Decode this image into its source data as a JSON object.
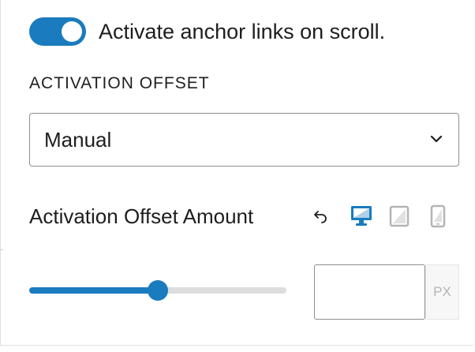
{
  "anchor_toggle": {
    "label": "Activate anchor links on scroll.",
    "checked": true
  },
  "activation_offset": {
    "heading": "ACTIVATION OFFSET",
    "selected": "Manual"
  },
  "offset_amount": {
    "label": "Activation Offset Amount",
    "icons": {
      "reset": "undo-arrow-icon",
      "desktop": "desktop-icon",
      "tablet": "tablet-icon",
      "mobile": "mobile-icon"
    },
    "active_device": "desktop",
    "slider_fraction": 0.5,
    "value": "",
    "unit": "PX"
  },
  "colors": {
    "accent": "#1a7bbe",
    "inactive_icon": "#b4b4b4",
    "track": "#dddddd",
    "border": "#8c8f94"
  }
}
